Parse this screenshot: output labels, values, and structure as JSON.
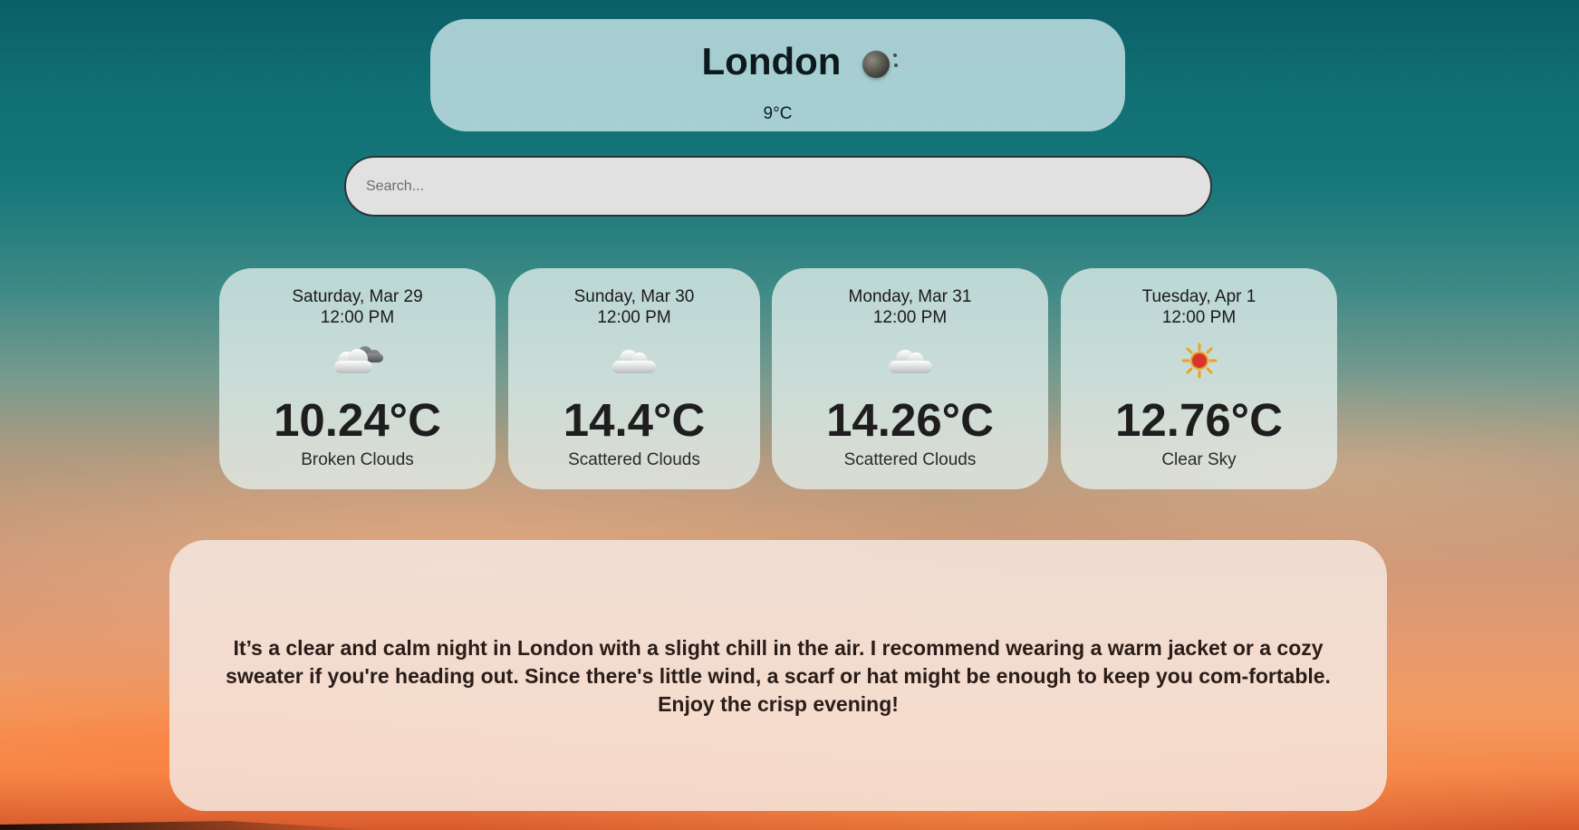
{
  "current": {
    "city": "London",
    "temperature": "9°C",
    "icon": "moon-icon"
  },
  "search": {
    "placeholder": "Search..."
  },
  "forecast": [
    {
      "date": "Saturday, Mar 29",
      "time": "12:00 PM",
      "icon": "broken-clouds-icon",
      "temperature": "10.24°C",
      "description": "Broken Clouds"
    },
    {
      "date": "Sunday, Mar 30",
      "time": "12:00 PM",
      "icon": "cloud-icon",
      "temperature": "14.4°C",
      "description": "Scattered Clouds"
    },
    {
      "date": "Monday, Mar 31",
      "time": "12:00 PM",
      "icon": "cloud-icon",
      "temperature": "14.26°C",
      "description": "Scattered Clouds"
    },
    {
      "date": "Tuesday, Apr 1",
      "time": "12:00 PM",
      "icon": "sun-icon",
      "temperature": "12.76°C",
      "description": "Clear Sky"
    }
  ],
  "advice": {
    "text": "It’s a clear and calm night in London with a slight chill in the air. I recommend wearing a warm jacket or a cozy sweater if you're heading out. Since there's little wind, a scarf or hat might be enough to keep you com-fortable. Enjoy the crisp evening!"
  },
  "colors": {
    "card_bg": "#c8e4e8",
    "search_bg": "#e1e1e1",
    "sun": "#d9342b",
    "text_dark": "#1a1a1a"
  }
}
